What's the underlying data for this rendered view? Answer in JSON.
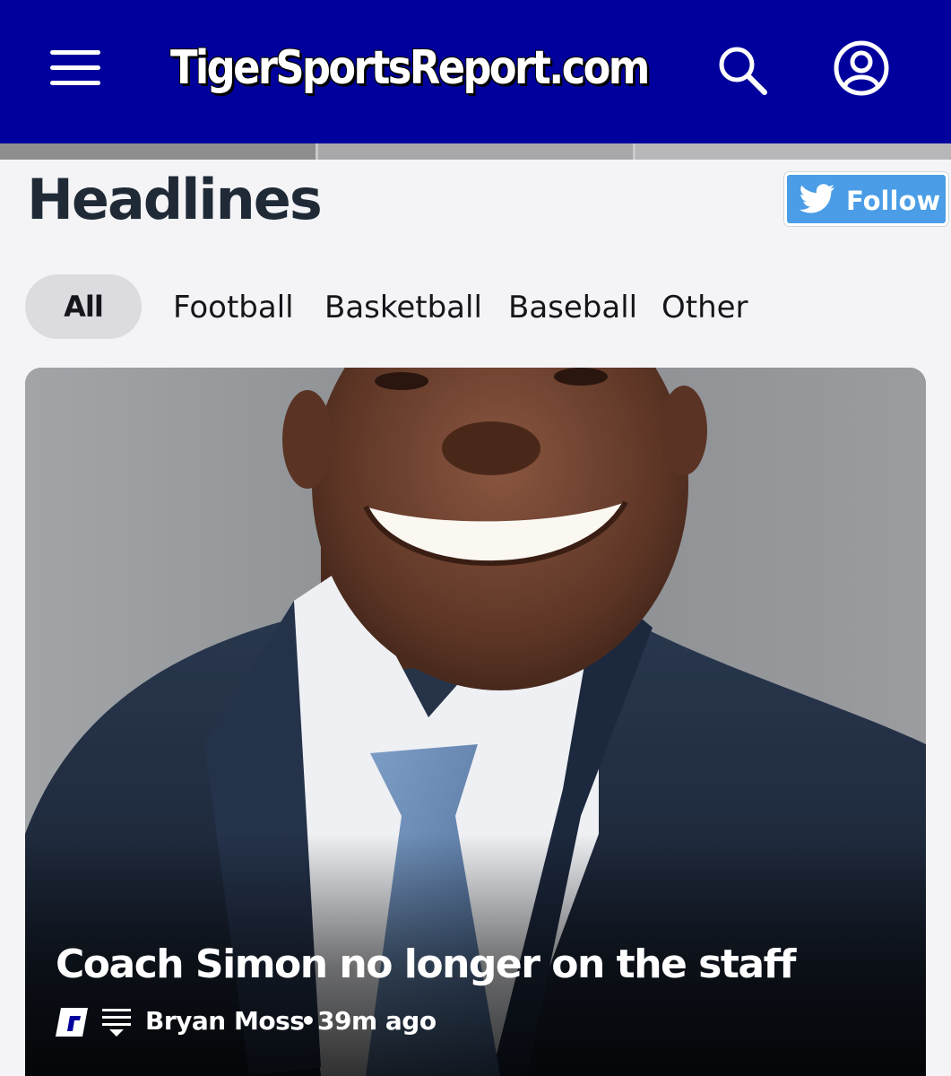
{
  "header": {
    "site_name": "TigerSportsReport.com",
    "background_color": "#00009c",
    "menu_icon": "hamburger-menu-icon",
    "search_icon": "search-icon",
    "profile_icon": "user-profile-icon"
  },
  "section": {
    "title": "Headlines",
    "follow_label": "Follow",
    "follow_icon": "twitter-bird-icon",
    "follow_color": "#4a9de6"
  },
  "tabs": [
    {
      "label": "All",
      "selected": true
    },
    {
      "label": "Football",
      "selected": false
    },
    {
      "label": "Basketball",
      "selected": false
    },
    {
      "label": "Baseball",
      "selected": false
    },
    {
      "label": "Other",
      "selected": false
    }
  ],
  "featured_article": {
    "title": "Coach Simon no longer on the staff",
    "source_icon": "rivals-logo-icon",
    "feed_icon": "feed-list-icon",
    "author": "Bryan Moss",
    "separator": "•",
    "time_ago": "39m ago"
  }
}
